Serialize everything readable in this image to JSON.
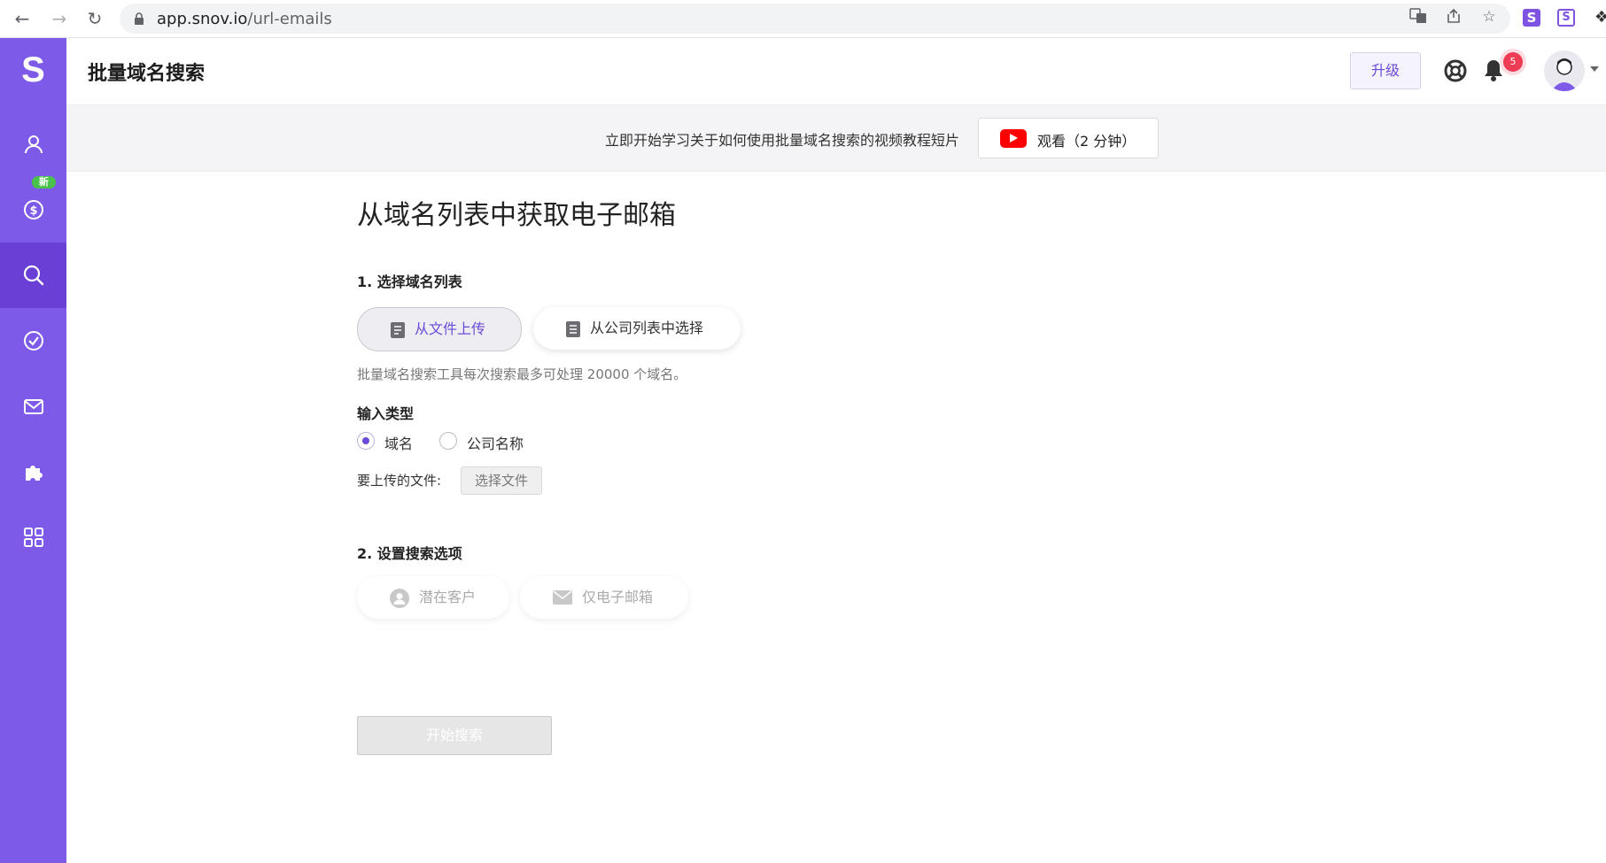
{
  "browser": {
    "url_host": "app.snov.io",
    "url_path": "/url-emails"
  },
  "sidebar": {
    "logo": "S",
    "new_badge": "新",
    "items": [
      {
        "icon": "user-icon"
      },
      {
        "icon": "dollar-icon"
      },
      {
        "icon": "search-icon"
      },
      {
        "icon": "check-circle-icon"
      },
      {
        "icon": "mail-icon"
      },
      {
        "icon": "puzzle-icon"
      },
      {
        "icon": "grid-icon"
      }
    ],
    "colors": {
      "background": "#7e5ae9",
      "active": "#6a3fd6"
    }
  },
  "header": {
    "title": "批量域名搜索",
    "upgrade_label": "升级",
    "notification_count": "5"
  },
  "banner": {
    "text": "立即开始学习关于如何使用批量域名搜索的视频教程短片",
    "watch_label": "观看（2 分钟）"
  },
  "main": {
    "heading": "从域名列表中获取电子邮箱",
    "step1_title": "1. 选择域名列表",
    "source_options": [
      {
        "label": "从文件上传",
        "selected": true
      },
      {
        "label": "从公司列表中选择",
        "selected": false
      }
    ],
    "hint": "批量域名搜索工具每次搜索最多可处理 20000 个域名。",
    "input_type_label": "输入类型",
    "input_types": [
      {
        "label": "域名",
        "checked": true
      },
      {
        "label": "公司名称",
        "checked": false
      }
    ],
    "file_label": "要上传的文件:",
    "file_button": "选择文件",
    "step2_title": "2. 设置搜索选项",
    "search_options": [
      {
        "label": "潜在客户",
        "icon": "person-icon"
      },
      {
        "label": "仅电子邮箱",
        "icon": "envelope-icon"
      }
    ],
    "start_button": "开始搜索"
  },
  "colors": {
    "accent": "#6b4ad8",
    "notification": "#ef3c55",
    "youtube": "#ff0000"
  }
}
